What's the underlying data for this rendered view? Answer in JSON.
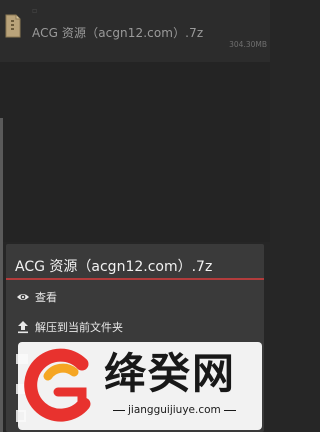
{
  "file": {
    "name": "ACG 资源（acgn12.com）.7z",
    "size": "304.30MB",
    "icon": "archive-file-icon"
  },
  "sheet": {
    "title": "ACG 资源（acgn12.com）.7z",
    "accent_color": "#b23c3c",
    "items": [
      {
        "label": "查看",
        "icon": "eye-icon"
      },
      {
        "label": "解压到当前文件夹",
        "icon": "upload-icon"
      }
    ]
  },
  "watermark": {
    "title": "绛癸网",
    "subtitle": "jiangguijiuye.com"
  }
}
